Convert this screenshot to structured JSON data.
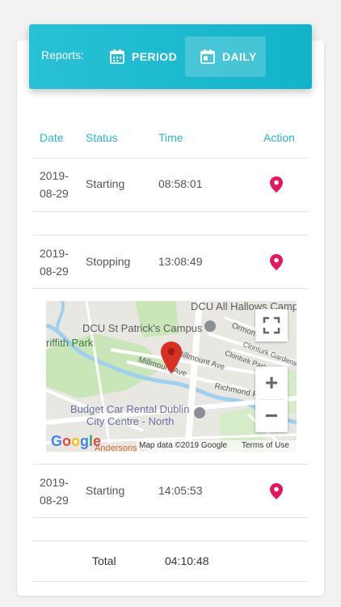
{
  "header": {
    "reports_label": "Reports:",
    "tabs": [
      {
        "label": "PERIOD",
        "icon": "calendar-icon",
        "active": false
      },
      {
        "label": "DAILY",
        "icon": "calendar-day-icon",
        "active": true
      }
    ]
  },
  "table": {
    "columns": [
      "Date",
      "Status",
      "Time",
      "Action"
    ],
    "rows": [
      {
        "date_year": "2019-",
        "date_rest": "08-29",
        "status": "Starting",
        "time": "08:58:01"
      },
      {
        "date_year": "2019-",
        "date_rest": "08-29",
        "status": "Stopping",
        "time": "13:08:49"
      },
      {
        "date_year": "2019-",
        "date_rest": "08-29",
        "status": "Starting",
        "time": "14:05:53"
      }
    ],
    "total_label": "Total",
    "total_value": "04:10:48"
  },
  "map": {
    "labels": {
      "dcu_all_hallows": "DCU All Hallows Camp",
      "dcu_st_patricks": "DCU St Patrick's Campus",
      "griffith_park": "riffith Park",
      "ormond": "Ormond",
      "clonturk_gardens": "Clonturk Gardens",
      "clonturk_park": "Clonturk Park",
      "millmount_ave_1": "Millmount Ave",
      "millmount_ave_2": "Millmount Ave",
      "richmond_rd": "Richmond Rd",
      "budget_line1": "Budget Car Rental Dublin",
      "budget_line2": "City Centre - North",
      "andersons": "Andersons Cr"
    },
    "footer": {
      "google": "Google",
      "map_data": "Map data ©2019 Google",
      "terms": "Terms of Use"
    },
    "controls": {
      "zoom_in": "+",
      "zoom_out": "−"
    }
  },
  "colors": {
    "accent": "#26b8cc",
    "header": "#1cb7cd",
    "pin": "#e8155b",
    "map_pin": "#d93025"
  }
}
